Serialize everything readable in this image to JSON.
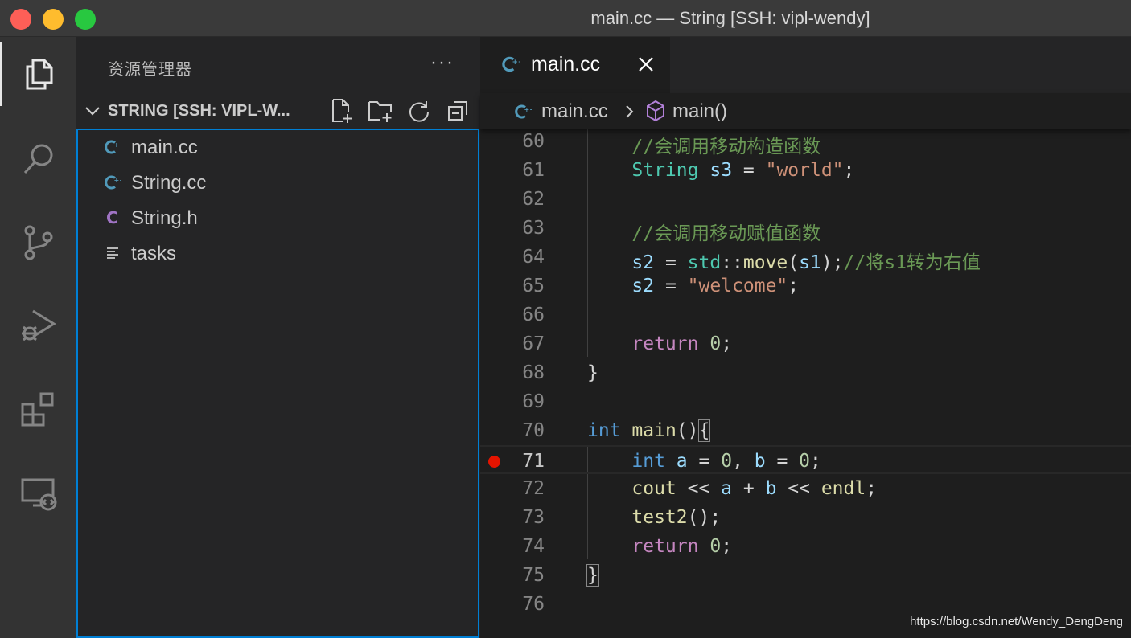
{
  "window": {
    "title": "main.cc — String [SSH: vipl-wendy]"
  },
  "activity_bar": [
    "explorer-icon",
    "search-icon",
    "source-control-icon",
    "run-debug-icon",
    "extensions-icon",
    "remote-explorer-icon"
  ],
  "sidebar": {
    "title": "资源管理器",
    "more": "···",
    "folder": "STRING [SSH: VIPL-W...",
    "files": [
      {
        "name": "main.cc",
        "icon": "cpp-icon"
      },
      {
        "name": "String.cc",
        "icon": "cpp-icon"
      },
      {
        "name": "String.h",
        "icon": "c-header-icon",
        "glyph": "C"
      },
      {
        "name": "tasks",
        "icon": "text-file-icon"
      }
    ]
  },
  "editor": {
    "tab": "main.cc",
    "breadcrumb": {
      "file": "main.cc",
      "symbol": "main()"
    },
    "current_line": "71",
    "breakpoint_line": "71",
    "lines": [
      {
        "num": "60",
        "text": "    //会调用移动构造函数"
      },
      {
        "num": "61",
        "text": "    String s3 = \"world\";"
      },
      {
        "num": "62",
        "text": ""
      },
      {
        "num": "63",
        "text": "    //会调用移动赋值函数"
      },
      {
        "num": "64",
        "text": "    s2 = std::move(s1);//将s1转为右值"
      },
      {
        "num": "65",
        "text": "    s2 = \"welcome\";"
      },
      {
        "num": "66",
        "text": ""
      },
      {
        "num": "67",
        "text": "    return 0;"
      },
      {
        "num": "68",
        "text": "}"
      },
      {
        "num": "69",
        "text": ""
      },
      {
        "num": "70",
        "text": "int main(){"
      },
      {
        "num": "71",
        "text": "    int a = 0, b = 0;"
      },
      {
        "num": "72",
        "text": "    cout << a + b << endl;"
      },
      {
        "num": "73",
        "text": "    test2();"
      },
      {
        "num": "74",
        "text": "    return 0;"
      },
      {
        "num": "75",
        "text": "}"
      },
      {
        "num": "76",
        "text": ""
      }
    ]
  },
  "watermark": "https://blog.csdn.net/Wendy_DengDeng",
  "colors": {
    "accent": "#007fd4",
    "breakpoint": "#e51400",
    "cpp_icon": "#519aba",
    "c_header_icon": "#a074c4"
  }
}
